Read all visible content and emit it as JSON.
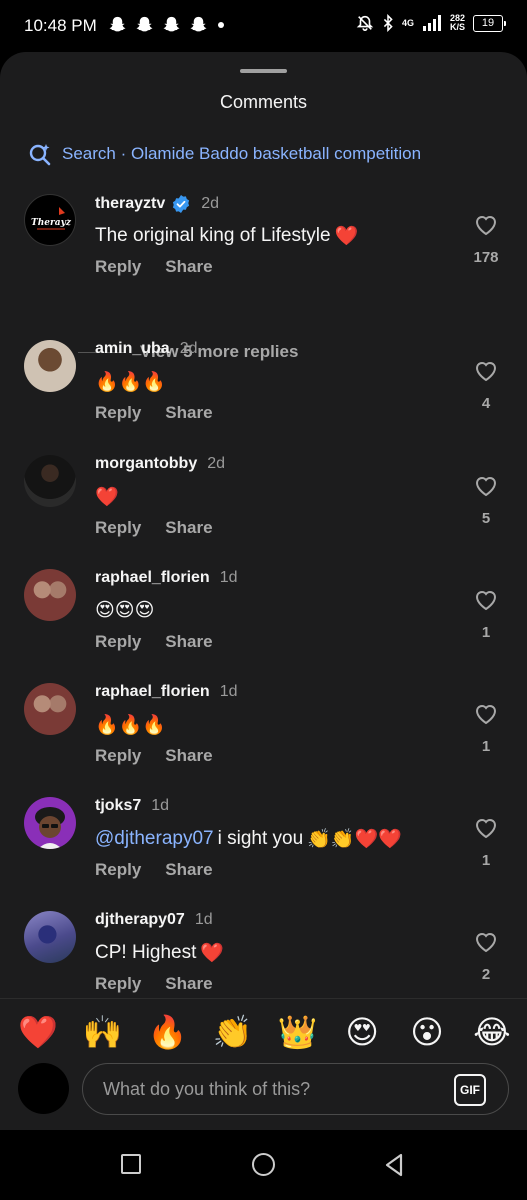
{
  "status_bar": {
    "time": "10:48 PM",
    "network_top": "4G",
    "net_speed_value": "282",
    "net_speed_unit": "K/S",
    "battery": "19"
  },
  "sheet": {
    "title": "Comments",
    "search_text": "Search · Olamide Baddo basketball competition"
  },
  "comments": [
    {
      "user": "therayztv",
      "verified": true,
      "time": "2d",
      "text": "The original king of Lifestyle",
      "emoji": "❤️",
      "likes": "178",
      "reply": "Reply",
      "share": "Share"
    },
    {
      "user": "amin_uba",
      "time": "2d",
      "emoji": "🔥🔥🔥",
      "likes": "4",
      "reply": "Reply",
      "share": "Share"
    },
    {
      "user": "morgantobby",
      "time": "2d",
      "emoji": "❤️",
      "likes": "5",
      "reply": "Reply",
      "share": "Share"
    },
    {
      "user": "raphael_florien",
      "time": "1d",
      "emoji": "😍😍😍",
      "likes": "1",
      "reply": "Reply",
      "share": "Share"
    },
    {
      "user": "raphael_florien",
      "time": "1d",
      "emoji": "🔥🔥🔥",
      "likes": "1",
      "reply": "Reply",
      "share": "Share"
    },
    {
      "user": "tjoks7",
      "time": "1d",
      "mention": "@djtherapy07",
      "text": "i sight you",
      "emoji": "👏👏❤️❤️",
      "likes": "1",
      "reply": "Reply",
      "share": "Share"
    },
    {
      "user": "djtherapy07",
      "time": "1d",
      "text": "CP! Highest",
      "emoji": "❤️",
      "likes": "2",
      "reply": "Reply",
      "share": "Share"
    }
  ],
  "view_more": "View 5 more replies",
  "avatar_logo_text": "Therayz",
  "reactions": [
    "❤️",
    "🙌",
    "🔥",
    "👏",
    "👑",
    "😍",
    "😮",
    "😂"
  ],
  "composer": {
    "placeholder": "What do you think of this?",
    "gif_label": "GIF"
  },
  "colors": {
    "sheet_bg": "#1c1c1d",
    "link_blue": "#8ab4ff",
    "verified_blue": "#3897f0"
  }
}
